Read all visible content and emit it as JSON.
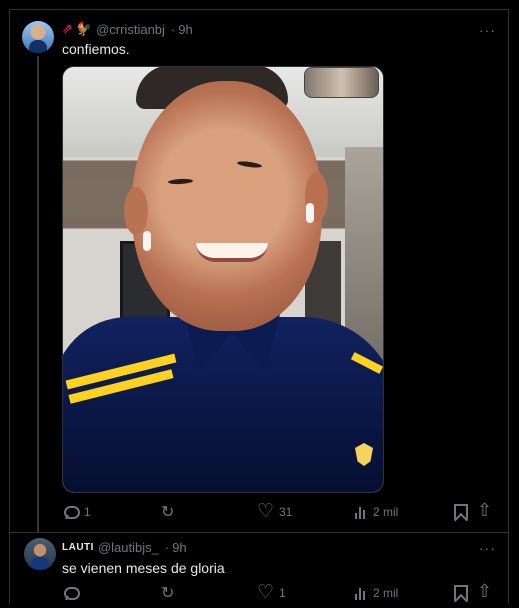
{
  "tweet1": {
    "display_name": "",
    "name_icons": [
      "rocket-icon",
      "rooster-icon"
    ],
    "handle": "@crristianbj",
    "time": "9h",
    "text": "confiemos.",
    "reply_count": "1",
    "retweet_count": "",
    "like_count": "31",
    "views_count": "2 mil"
  },
  "tweet2": {
    "display_name": "LAUTI",
    "handle": "@lautibjs_",
    "time": "9h",
    "text": "se vienen meses de gloria",
    "reply_count": "",
    "retweet_count": "",
    "like_count": "1",
    "views_count": "2 mil"
  },
  "ui": {
    "more_label": "···"
  },
  "colors": {
    "background": "#000000",
    "primary_text": "#e7e9ea",
    "secondary_text": "#71767b",
    "border": "#2f3336"
  }
}
